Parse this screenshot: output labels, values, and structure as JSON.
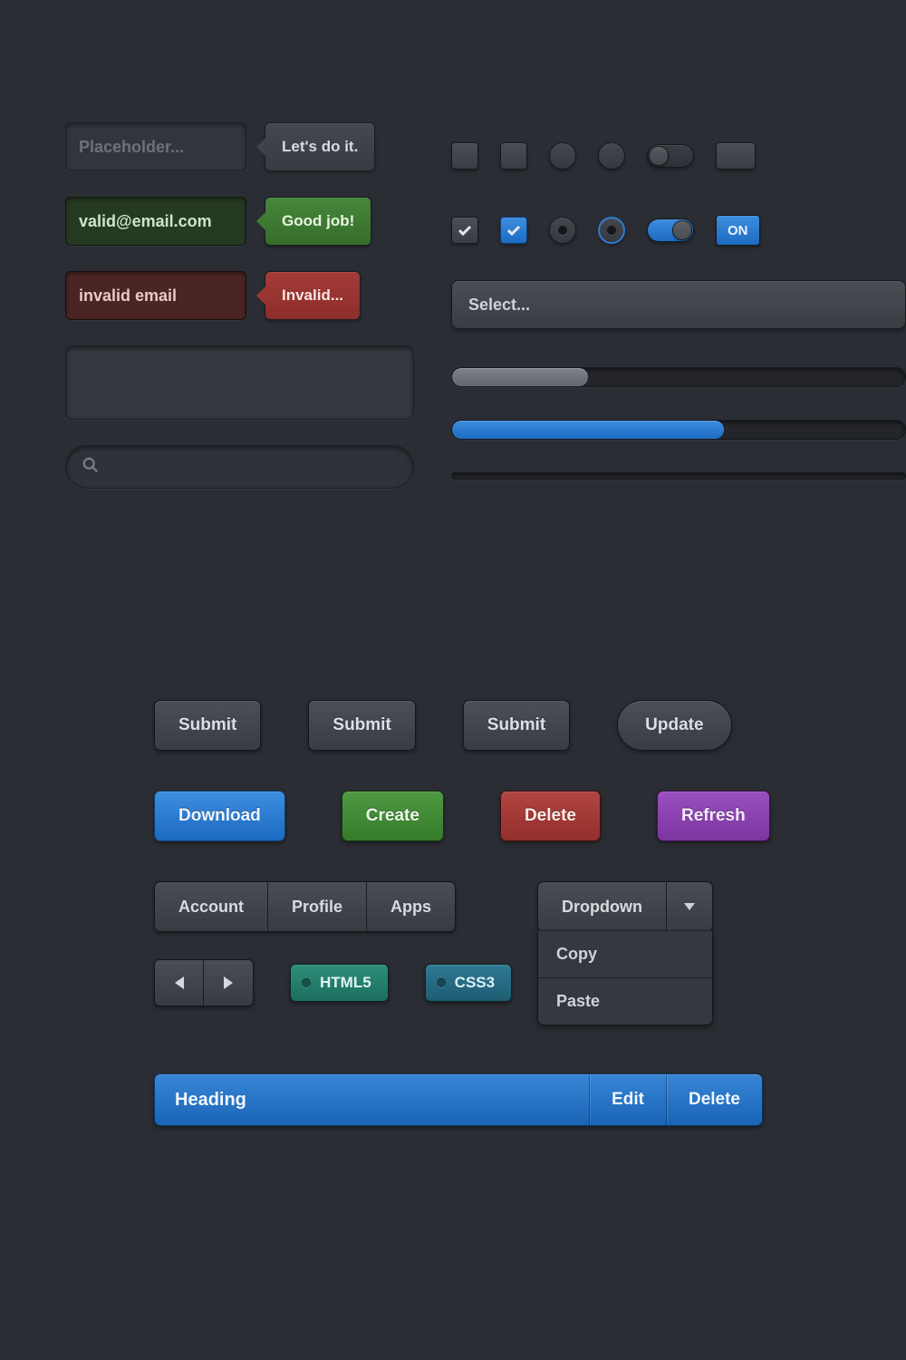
{
  "inputs": {
    "default_placeholder": "Placeholder...",
    "default_tooltip": "Let's do it.",
    "valid_value": "valid@email.com",
    "valid_tooltip": "Good job!",
    "invalid_value": "invalid email",
    "invalid_tooltip": "Invalid..."
  },
  "toggle": {
    "on_label": "ON"
  },
  "select": {
    "placeholder": "Select..."
  },
  "progress": {
    "grey_pct": 30,
    "blue_pct": 60
  },
  "buttons": {
    "submit": "Submit",
    "update": "Update",
    "download": "Download",
    "create": "Create",
    "delete": "Delete",
    "refresh": "Refresh"
  },
  "segmented": {
    "items": [
      "Account",
      "Profile",
      "Apps"
    ]
  },
  "dropdown": {
    "label": "Dropdown",
    "items": [
      "Copy",
      "Paste"
    ]
  },
  "tags": {
    "html5": "HTML5",
    "css3": "CSS3"
  },
  "heading": {
    "title": "Heading",
    "edit": "Edit",
    "delete": "Delete"
  }
}
